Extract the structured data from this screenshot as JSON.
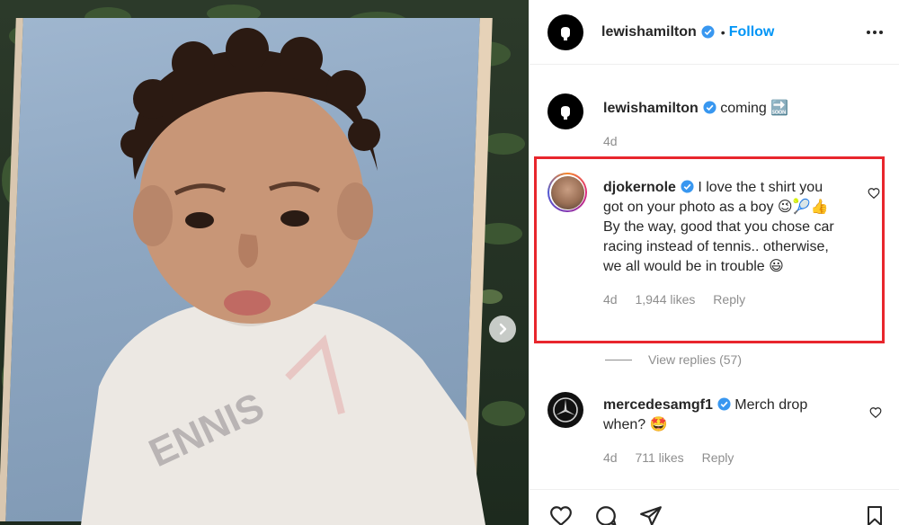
{
  "post": {
    "author": "lewishamilton",
    "follow_label": "Follow",
    "dot": "•"
  },
  "photo": {
    "shirt_text": "ENNIS"
  },
  "caption": {
    "username": "lewishamilton",
    "text": "coming",
    "emoji": "🔜",
    "time": "4d"
  },
  "comments": [
    {
      "username": "djokernole",
      "text": "I love the t shirt you got on your photo as a boy 😉🎾👍 By the way, good that you chose car racing instead of tennis.. otherwise, we all would be in trouble 😃",
      "time": "4d",
      "likes": "1,944 likes",
      "reply_label": "Reply"
    },
    {
      "username": "mercedesamgf1",
      "text": "Merch drop when? 🤩",
      "time": "4d",
      "likes": "711 likes",
      "reply_label": "Reply"
    }
  ],
  "view_replies": "View replies (57)",
  "icons": [
    "verified-badge-icon",
    "more-options-icon",
    "heart-icon",
    "comment-icon",
    "share-icon",
    "bookmark-icon",
    "chevron-right-icon"
  ]
}
